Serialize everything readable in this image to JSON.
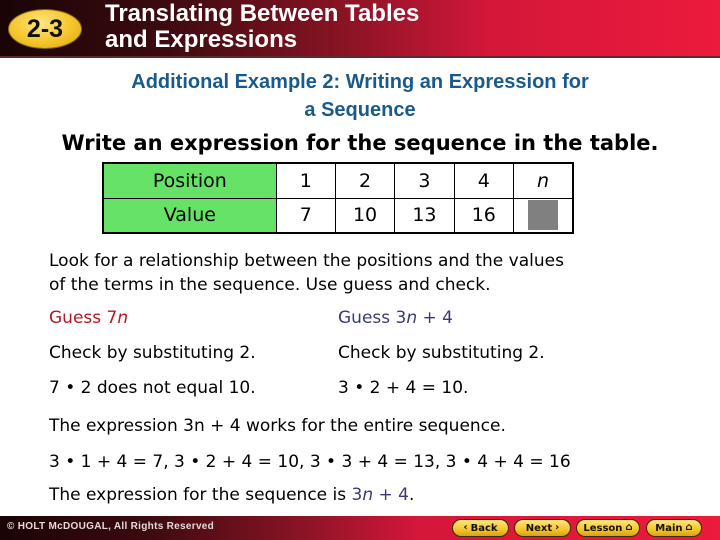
{
  "header": {
    "lesson_number": "2-3",
    "title_line1": "Translating Between Tables",
    "title_line2": "and Expressions"
  },
  "subtitle": {
    "line1": "Additional Example 2: Writing an Expression for",
    "line2": "a Sequence"
  },
  "instruction": "Write an expression for the sequence in the table.",
  "table": {
    "rows": [
      {
        "label": "Position",
        "cells": [
          "1",
          "2",
          "3",
          "4",
          "n"
        ]
      },
      {
        "label": "Value",
        "cells": [
          "7",
          "10",
          "13",
          "16",
          ""
        ]
      }
    ],
    "unknown_cell_color": "#808080",
    "label_bg_color": "#66e366"
  },
  "body": {
    "intro_line1": "Look for a relationship between the positions and the values",
    "intro_line2": "of the terms in the sequence. Use guess and check.",
    "guess1": {
      "prefix": "Guess 7",
      "var": "n",
      "suffix": ""
    },
    "guess2": {
      "prefix": "Guess 3",
      "var": "n",
      "suffix": " + 4"
    },
    "check1": "Check by substituting 2.",
    "check2": "Check by substituting 2.",
    "result1": "7 • 2 does not equal 10.",
    "result2": "3 • 2 + 4 = 10.",
    "works_statement": "The expression 3n + 4 works for the entire sequence.",
    "verification": "3 • 1 + 4 = 7, 3 • 2 + 4 = 10, 3 • 3 + 4 = 13, 3 • 4 + 4 = 16",
    "conclusion_prefix": "The expression for the sequence is ",
    "conclusion_expr_prefix": "3",
    "conclusion_var": "n",
    "conclusion_expr_suffix": " + 4",
    "conclusion_end": "."
  },
  "colors": {
    "guess1": "#b01a24",
    "guess2": "#3a3a78",
    "subtitle": "#1a5a8a"
  },
  "footer": {
    "copyright": "© HOLT McDOUGAL, All Rights Reserved",
    "buttons": {
      "back": {
        "label": "Back",
        "icon": "‹"
      },
      "next": {
        "label": "Next",
        "icon": "›"
      },
      "lesson": {
        "label": "Lesson",
        "icon": "⌂"
      },
      "main": {
        "label": "Main",
        "icon": "⌂"
      }
    }
  }
}
